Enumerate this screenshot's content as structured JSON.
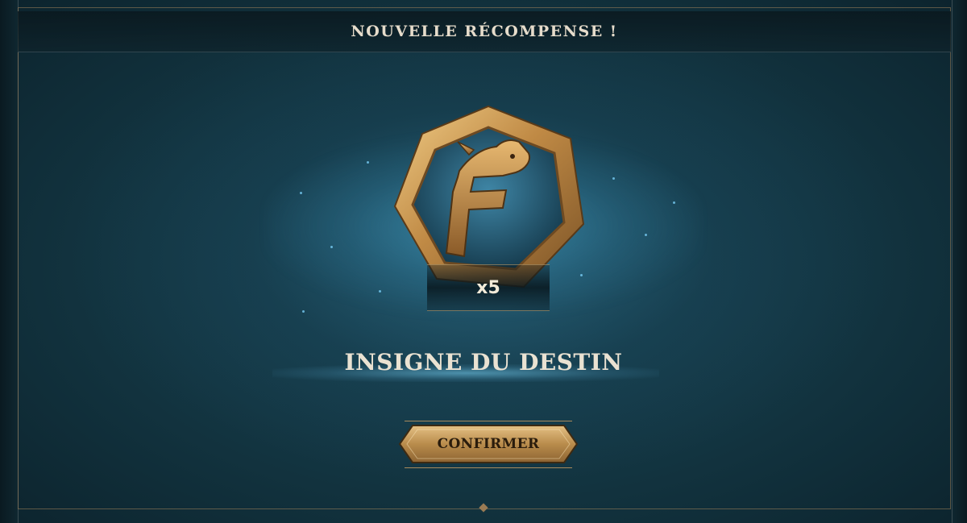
{
  "header": {
    "title": "NOUVELLE RÉCOMPENSE !"
  },
  "reward": {
    "icon": "dragon-f-insignia-icon",
    "emblem_letter": "F",
    "quantity": "x5",
    "name": "INSIGNE DU DESTIN"
  },
  "actions": {
    "confirm_label": "CONFIRMER"
  },
  "colors": {
    "accent_gold": "#c9a05a",
    "background_teal": "#12333f",
    "glow_blue": "#5fc4f0",
    "text_light": "#eae2d2"
  }
}
